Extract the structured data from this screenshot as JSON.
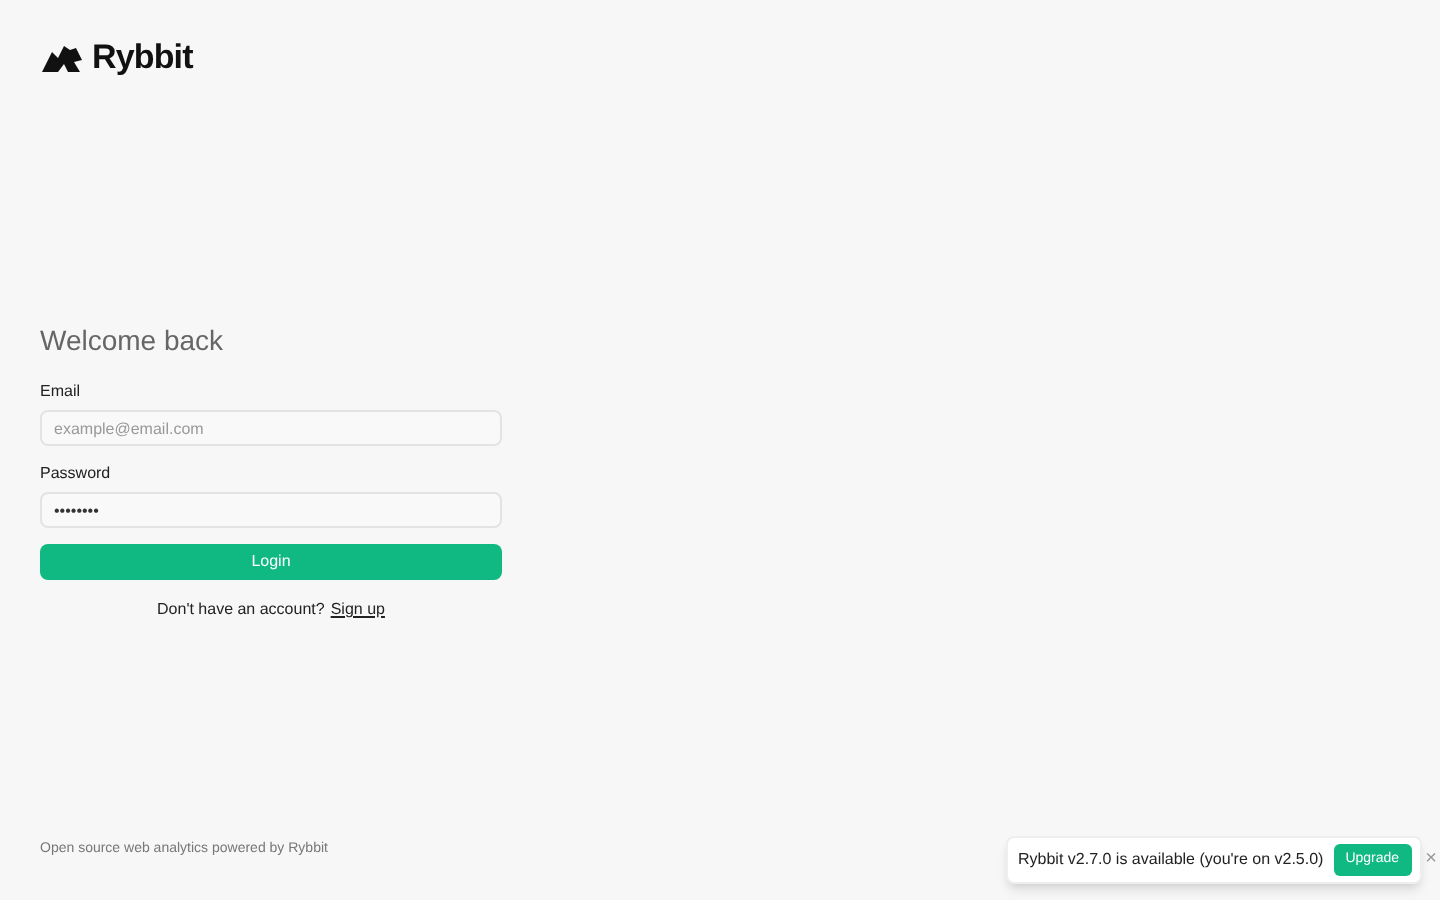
{
  "brand": {
    "name": "Rybbit"
  },
  "form": {
    "heading": "Welcome back",
    "fields": [
      {
        "label": "Email",
        "placeholder": "example@email.com"
      },
      {
        "label": "Password",
        "value": "••••••••"
      }
    ],
    "submit": "Login",
    "signup_prompt": "Don't have an account?",
    "signup_link": "Sign up"
  },
  "footer": "Open source web analytics powered by Rybbit",
  "toast": {
    "message": "Rybbit v2.7.0 is available (you're on v2.5.0)",
    "button": "Upgrade",
    "close": "×"
  }
}
